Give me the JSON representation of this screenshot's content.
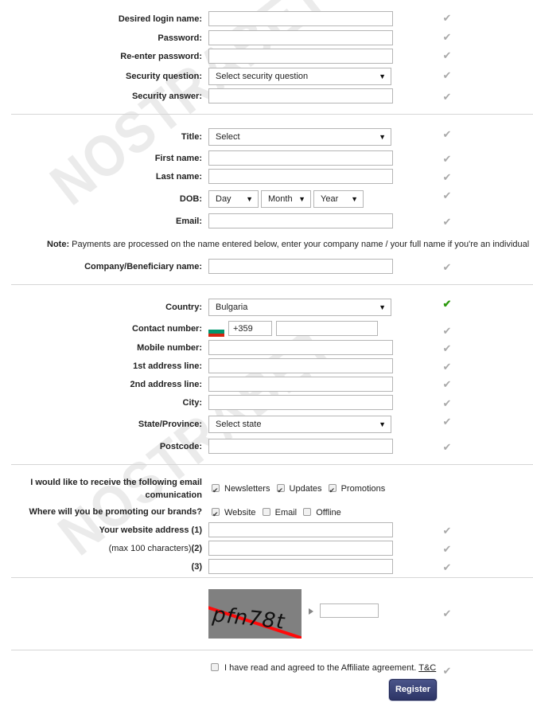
{
  "watermark": "NOSTRABET",
  "account": {
    "fields": [
      {
        "label": "Desired login name:",
        "type": "text",
        "value": ""
      },
      {
        "label": "Password:",
        "type": "password",
        "value": ""
      },
      {
        "label": "Re-enter password:",
        "type": "password",
        "value": ""
      },
      {
        "label": "Security question:",
        "type": "select",
        "value": "Select security question"
      },
      {
        "label": "Security answer:",
        "type": "text",
        "value": ""
      }
    ]
  },
  "personal": {
    "title_label": "Title:",
    "title_value": "Select",
    "first_name_label": "First name:",
    "last_name_label": "Last name:",
    "dob_label": "DOB:",
    "dob_day": "Day",
    "dob_month": "Month",
    "dob_year": "Year",
    "email_label": "Email:",
    "note_prefix": "Note:",
    "note_text": " Payments are processed on the name entered below, enter your company name / your full name if you're an individual",
    "company_label": "Company/Beneficiary name:"
  },
  "address": {
    "country_label": "Country:",
    "country_value": "Bulgaria",
    "contact_label": "Contact number:",
    "dial_code": "+359",
    "flag_colors": [
      "#ffffff",
      "#00966e",
      "#d62612"
    ],
    "mobile_label": "Mobile number:",
    "address1_label": "1st address line:",
    "address2_label": "2nd address line:",
    "city_label": "City:",
    "state_label": "State/Province:",
    "state_value": "Select state",
    "postcode_label": "Postcode:"
  },
  "promotion": {
    "email_comm_label_line1": "I would like to receive the following email",
    "email_comm_label_line2": "comunication",
    "email_options": [
      {
        "label": "Newsletters",
        "checked": true
      },
      {
        "label": "Updates",
        "checked": true
      },
      {
        "label": "Promotions",
        "checked": true
      }
    ],
    "promote_label": "Where will you be promoting our brands?",
    "promote_options": [
      {
        "label": "Website",
        "checked": true
      },
      {
        "label": "Email",
        "checked": false
      },
      {
        "label": "Offline",
        "checked": false
      }
    ],
    "website1_label": "Your website address (1)",
    "website2_hint": "(max 100 characters)",
    "website2_label": "(2)",
    "website3_label": "(3)"
  },
  "captcha": {
    "text": "pfn78t",
    "value": ""
  },
  "agreement": {
    "text": "I have read and agreed to the Affiliate agreement. ",
    "link": "T&C",
    "checked": false
  },
  "register_label": "Register",
  "colors": {
    "valid_check": "#2e9a10",
    "pending_check": "#a9a9a9",
    "button": "#2d3566"
  }
}
